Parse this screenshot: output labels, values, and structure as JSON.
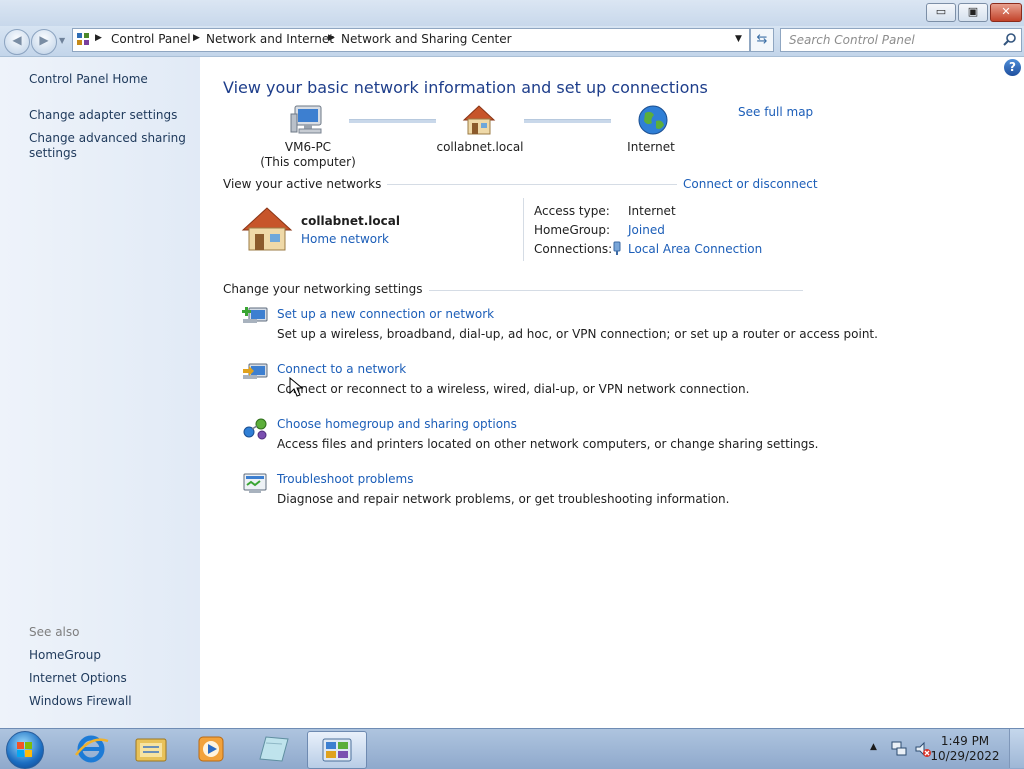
{
  "window": {
    "caption_buttons": {
      "minimize": "▭",
      "restore": "▣",
      "close": "✕"
    }
  },
  "address": {
    "crumbs": [
      "Control Panel",
      "Network and Internet",
      "Network and Sharing Center"
    ],
    "search_placeholder": "Search Control Panel"
  },
  "sidebar": {
    "home": "Control Panel Home",
    "links": [
      "Change adapter settings",
      "Change advanced sharing settings"
    ],
    "see_also_heading": "See also",
    "see_also": [
      "HomeGroup",
      "Internet Options",
      "Windows Firewall"
    ]
  },
  "main": {
    "title": "View your basic network information and set up connections",
    "see_full_map": "See full map",
    "map": {
      "computer_name": "VM6-PC",
      "computer_sub": "(This computer)",
      "network": "collabnet.local",
      "internet": "Internet"
    },
    "active_networks": {
      "heading": "View your active networks",
      "connect_link": "Connect or disconnect",
      "network_name": "collabnet.local",
      "network_type": "Home network",
      "access_type_label": "Access type:",
      "access_type_value": "Internet",
      "homegroup_label": "HomeGroup:",
      "homegroup_value": "Joined",
      "connections_label": "Connections:",
      "connections_value": "Local Area Connection"
    },
    "settings": {
      "heading": "Change your networking settings",
      "tasks": [
        {
          "link": "Set up a new connection or network",
          "desc": "Set up a wireless, broadband, dial-up, ad hoc, or VPN connection; or set up a router or access point."
        },
        {
          "link": "Connect to a network",
          "desc": "Connect or reconnect to a wireless, wired, dial-up, or VPN network connection."
        },
        {
          "link": "Choose homegroup and sharing options",
          "desc": "Access files and printers located on other network computers, or change sharing settings."
        },
        {
          "link": "Troubleshoot problems",
          "desc": "Diagnose and repair network problems, or get troubleshooting information."
        }
      ]
    }
  },
  "taskbar": {
    "time": "1:49 PM",
    "date": "10/29/2022"
  },
  "colors": {
    "link": "#1c5eb8",
    "title": "#1e3e8b",
    "sidebar_bg": "#e6eef8",
    "taskbar": "#a4bcda"
  },
  "icons": [
    "computer-icon",
    "house-icon",
    "globe-icon",
    "wired-connection-icon",
    "new-connection-icon",
    "connect-network-icon",
    "homegroup-icon",
    "troubleshoot-icon",
    "help-icon",
    "search-icon",
    "refresh-icon",
    "back-icon",
    "forward-icon"
  ]
}
